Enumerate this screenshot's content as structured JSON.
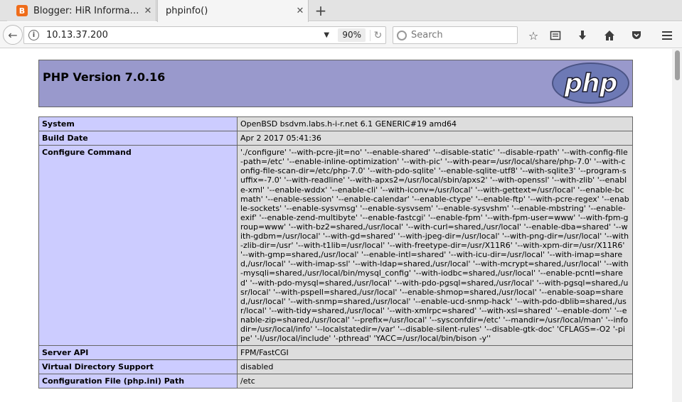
{
  "tabs": [
    {
      "title": "Blogger: HiR Informa…",
      "favicon": "blogger-icon",
      "active": false
    },
    {
      "title": "phpinfo()",
      "active": true
    }
  ],
  "navbar": {
    "url": "10.13.37.200",
    "zoom": "90%",
    "search_placeholder": "Search"
  },
  "page": {
    "title": "PHP Version 7.0.16",
    "logo_text": "php",
    "rows": [
      {
        "key": "System",
        "value": "OpenBSD bsdvm.labs.h-i-r.net 6.1 GENERIC#19 amd64"
      },
      {
        "key": "Build Date",
        "value": "Apr 2 2017 05:41:36"
      },
      {
        "key": "Configure Command",
        "value": "'./configure' '--with-pcre-jit=no' '--enable-shared' '--disable-static' '--disable-rpath' '--with-config-file-path=/etc' '--enable-inline-optimization' '--with-pic' '--with-pear=/usr/local/share/php-7.0' '--with-config-file-scan-dir=/etc/php-7.0' '--with-pdo-sqlite' '--enable-sqlite-utf8' '--with-sqlite3' '--program-suffix=-7.0' '--with-readline' '--with-apxs2=/usr/local/sbin/apxs2' '--with-openssl' '--with-zlib' '--enable-xml' '--enable-wddx' '--enable-cli' '--with-iconv=/usr/local' '--with-gettext=/usr/local' '--enable-bcmath' '--enable-session' '--enable-calendar' '--enable-ctype' '--enable-ftp' '--with-pcre-regex' '--enable-sockets' '--enable-sysvmsg' '--enable-sysvsem' '--enable-sysvshm' '--enable-mbstring' '--enable-exif' '--enable-zend-multibyte' '--enable-fastcgi' '--enable-fpm' '--with-fpm-user=www' '--with-fpm-group=www' '--with-bz2=shared,/usr/local' '--with-curl=shared,/usr/local' '--enable-dba=shared' '--with-gdbm=/usr/local' '--with-gd=shared' '--with-jpeg-dir=/usr/local' '--with-png-dir=/usr/local' '--with-zlib-dir=/usr' '--with-t1lib=/usr/local' '--with-freetype-dir=/usr/X11R6' '--with-xpm-dir=/usr/X11R6' '--with-gmp=shared,/usr/local' '--enable-intl=shared' '--with-icu-dir=/usr/local' '--with-imap=shared,/usr/local' '--with-imap-ssl' '--with-ldap=shared,/usr/local' '--with-mcrypt=shared,/usr/local' '--with-mysqli=shared,/usr/local/bin/mysql_config' '--with-iodbc=shared,/usr/local' '--enable-pcntl=shared' '--with-pdo-mysql=shared,/usr/local' '--with-pdo-pgsql=shared,/usr/local' '--with-pgsql=shared,/usr/local' '--with-pspell=shared,/usr/local' '--enable-shmop=shared,/usr/local' '--enable-soap=shared,/usr/local' '--with-snmp=shared,/usr/local' '--enable-ucd-snmp-hack' '--with-pdo-dblib=shared,/usr/local' '--with-tidy=shared,/usr/local' '--with-xmlrpc=shared' '--with-xsl=shared' '--enable-dom' '--enable-zip=shared,/usr/local' '--prefix=/usr/local' '--sysconfdir=/etc' '--mandir=/usr/local/man' '--infodir=/usr/local/info' '--localstatedir=/var' '--disable-silent-rules' '--disable-gtk-doc' 'CFLAGS=-O2 '-pipe' '-I/usr/local/include' '-pthread' 'YACC=/usr/local/bin/bison -y''"
      },
      {
        "key": "Server API",
        "value": "FPM/FastCGI"
      },
      {
        "key": "Virtual Directory Support",
        "value": "disabled"
      },
      {
        "key": "Configuration File (php.ini) Path",
        "value": "/etc"
      }
    ]
  }
}
